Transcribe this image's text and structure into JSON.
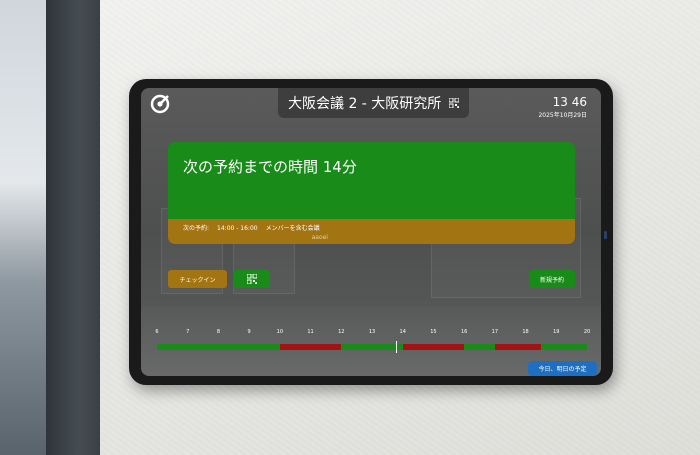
{
  "header": {
    "room_title": "大阪会議 2 - 大阪研究所",
    "time": "13 46",
    "date": "2025年10月29日"
  },
  "next_booking": {
    "time_until": "次の予約までの時間 14分",
    "label": "次の予約:",
    "time_range": "14:00 - 16:00",
    "meeting_name": "メンバーを含む会議",
    "organizer": "aaoei"
  },
  "actions": {
    "checkin_label": "チェックイン",
    "new_booking_label": "新規予約",
    "schedule_label": "今日、明日の予定"
  },
  "timeline": {
    "hours": [
      "6",
      "7",
      "8",
      "9",
      "10",
      "11",
      "12",
      "13",
      "14",
      "15",
      "16",
      "17",
      "18",
      "19",
      "20"
    ],
    "busy": [
      [
        10,
        12
      ],
      [
        14,
        16
      ],
      [
        17,
        18.5
      ]
    ],
    "now": 13.77
  },
  "colors": {
    "free": "#188b18",
    "busy": "#a31313",
    "upcoming": "#a37412",
    "action": "#1e6fc0"
  }
}
